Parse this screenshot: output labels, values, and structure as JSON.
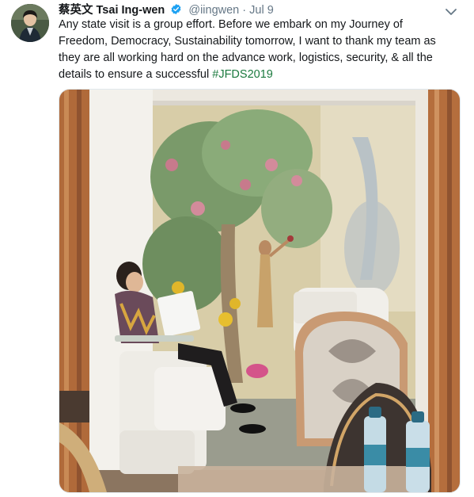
{
  "tweet": {
    "display_name": "蔡英文 Tsai Ing-wen",
    "handle": "@iingwen",
    "separator": "·",
    "date": "Jul 9",
    "text": "Any state visit is a group effort. Before we embark on my Journey of Freedom, Democracy, Sustainability tomorrow, I want to thank my team as they are all working hard on the advance work, logistics, security, & all the details to ensure a successful ",
    "hashtag": "#JFDS2019"
  },
  "colors": {
    "text_primary": "#14171a",
    "text_secondary": "#657786",
    "hashtag": "#1b7a3e",
    "verified": "#1da1f2"
  },
  "icons": {
    "verified": "verified-badge-icon",
    "menu": "chevron-down-icon"
  }
}
